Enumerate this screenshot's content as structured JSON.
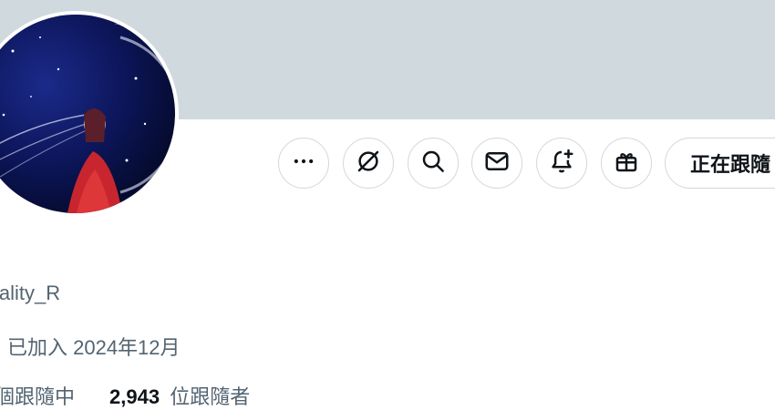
{
  "profile": {
    "handle": "iality_R",
    "joined": "已加入 2024年12月",
    "following_label": "個跟隨中",
    "followers_count": "2,943",
    "followers_label": "位跟隨者"
  },
  "actions": {
    "follow_label": "正在跟隨"
  },
  "icons": [
    "more-icon",
    "grok-icon",
    "search-icon",
    "mail-icon",
    "bell-plus-icon",
    "gift-icon"
  ],
  "colors": {
    "banner": "#cfd9de",
    "border": "#cfd9de",
    "text_primary": "#0f1419",
    "text_secondary": "#536471"
  }
}
